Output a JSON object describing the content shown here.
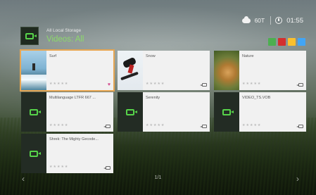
{
  "status": {
    "weather_icon": "cloud-icon",
    "temperature": "60T",
    "clock_icon": "clock-icon",
    "time": "01:55"
  },
  "header": {
    "icon": "video-camera-icon",
    "subtitle": "All Local Storage",
    "title": "Videos: All"
  },
  "color_keys": [
    "#4caf50",
    "#d32f2f",
    "#fbc02d",
    "#42a5f5"
  ],
  "tiles": [
    {
      "name": "Surf",
      "thumb": "surf",
      "favorite": true
    },
    {
      "name": "Snow",
      "thumb": "snow",
      "favorite": false
    },
    {
      "name": "Nature",
      "thumb": "nature",
      "favorite": false
    },
    {
      "name": "Multilanguage LTFR 667 ...",
      "thumb": "icon",
      "favorite": false
    },
    {
      "name": "Serenity",
      "thumb": "icon",
      "favorite": false
    },
    {
      "name": "VIDEO_TS.VOB",
      "thumb": "icon",
      "favorite": false
    },
    {
      "name": "Shrek: The Mighty Gecode...",
      "thumb": "icon",
      "favorite": false
    }
  ],
  "footer": {
    "page": "1/1",
    "prev_icon": "chevron-left-icon",
    "next_icon": "chevron-right-icon",
    "prev_glyph": "‹",
    "next_glyph": "›"
  }
}
